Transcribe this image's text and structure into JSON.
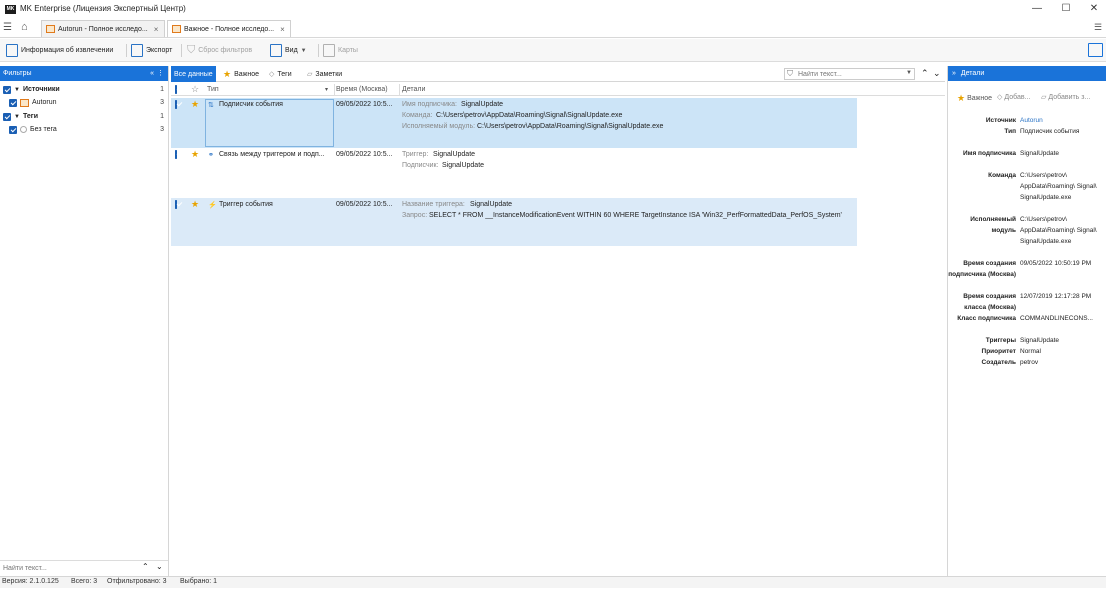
{
  "window": {
    "icon_text": "MK",
    "title": "MK Enterprise (Лицензия Экспертный Центр)",
    "minimize": "—",
    "maximize": "☐",
    "close": "✕"
  },
  "tabs": [
    {
      "label": "Autorun - Полное исследо..."
    },
    {
      "label": "Важное - Полное исследо..."
    }
  ],
  "toolbar": {
    "info": "Информация об извлечении",
    "export": "Экспорт",
    "reset_filters": "Сброс фильтров",
    "view": "Вид",
    "maps": "Карты"
  },
  "filters": {
    "header": "Фильтры",
    "sources_label": "Источники",
    "sources_count": "1",
    "autorun_label": "Autorun",
    "autorun_count": "3",
    "tags_label": "Теги",
    "tags_count": "1",
    "no_tag_label": "Без тега",
    "no_tag_count": "3",
    "search_placeholder": "Найти текст..."
  },
  "view_tabs": {
    "all": "Все данные",
    "important": "Важное",
    "tags": "Теги",
    "notes": "Заметки",
    "search_placeholder": "Найти текст..."
  },
  "columns": {
    "type": "Тип",
    "time": "Время (Москва)",
    "details": "Детали"
  },
  "rows": [
    {
      "type": "Подписчик события",
      "time": "09/05/2022 10:5...",
      "d1k": "Имя подписчика:",
      "d1v": "SignalUpdate",
      "d2k": "Команда:",
      "d2v": "C:\\Users\\petrov\\AppData\\Roaming\\Signal\\SignalUpdate.exe",
      "d3k": "Исполняемый модуль:",
      "d3v": "C:\\Users\\petrov\\AppData\\Roaming\\Signal\\SignalUpdate.exe"
    },
    {
      "type": "Связь между триггером и подп...",
      "time": "09/05/2022 10:5...",
      "d1k": "Триггер:",
      "d1v": "SignalUpdate",
      "d2k": "Подписчик:",
      "d2v": "SignalUpdate"
    },
    {
      "type": "Триггер события",
      "time": "09/05/2022 10:5...",
      "d1k": "Название триггера:",
      "d1v": "SignalUpdate",
      "d2k": "Запрос:",
      "d2v": "SELECT * FROM __InstanceModificationEvent WITHIN 60 WHERE TargetInstance ISA 'Win32_PerfFormattedData_PerfOS_System'"
    }
  ],
  "details": {
    "header": "Детали",
    "important": "Важное",
    "add1": "Добав...",
    "add2": "Добавить з...",
    "fields": [
      {
        "k": "Источник",
        "v": "Autorun"
      },
      {
        "k": "Тип",
        "v": "Подписчик события"
      },
      {
        "k": "Имя подписчика",
        "v": "SignalUpdate"
      },
      {
        "k": "Команда",
        "v": "C:\\Users\\petrov\\ AppData\\Roaming\\ Signal\\ SignalUpdate.exe"
      },
      {
        "k": "Исполняемый модуль",
        "v": "C:\\Users\\petrov\\ AppData\\Roaming\\ Signal\\ SignalUpdate.exe"
      },
      {
        "k": "Время создания подписчика (Москва)",
        "v": "09/05/2022 10:50:19 PM"
      },
      {
        "k": "Время создания класса (Москва)",
        "v": "12/07/2019 12:17:28 PM"
      },
      {
        "k": "Класс подписчика",
        "v": "COMMANDLINECONS..."
      },
      {
        "k": "Триггеры",
        "v": "SignalUpdate"
      },
      {
        "k": "Приоритет",
        "v": "Normal"
      },
      {
        "k": "Создатель",
        "v": "petrov"
      }
    ]
  },
  "status": {
    "version": "Версия: 2.1.0.125",
    "total": "Всего: 3",
    "filtered": "Отфильтровано: 3",
    "selected": "Выбрано: 1"
  }
}
